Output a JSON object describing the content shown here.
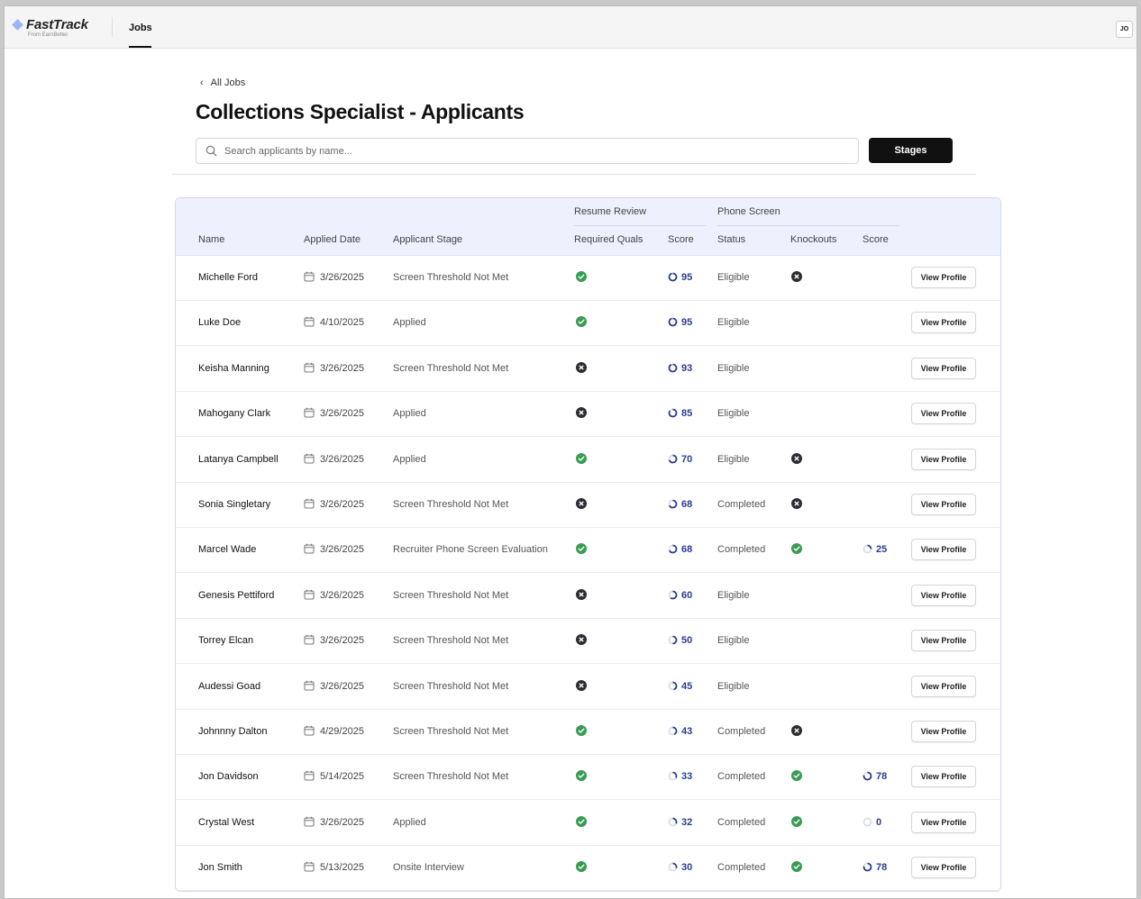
{
  "app": {
    "logo": "FastTrack",
    "logo_sub": "From EarnBetter",
    "nav_jobs": "Jobs",
    "avatar": "JO"
  },
  "page": {
    "back_label": "All Jobs",
    "title": "Collections Specialist - Applicants",
    "search_placeholder": "Search applicants by name...",
    "stages_label": "Stages"
  },
  "table": {
    "groups": {
      "resume_review": "Resume Review",
      "phone_screen": "Phone Screen"
    },
    "headers": {
      "name": "Name",
      "applied_date": "Applied Date",
      "stage": "Applicant Stage",
      "required_quals": "Required Quals",
      "resume_score": "Score",
      "status": "Status",
      "knockouts": "Knockouts",
      "phone_score": "Score"
    },
    "view_label": "View Profile",
    "colors": {
      "ok": "#3a9b55",
      "fail": "#2b2d33",
      "score": "#2a3d8f"
    },
    "rows": [
      {
        "name": "Michelle Ford",
        "date": "3/26/2025",
        "stage": "Screen Threshold Not Met",
        "quals": "ok",
        "score": "95",
        "score_value": 95,
        "status": "Eligible",
        "knockouts": "fail",
        "phone_score": "",
        "phone_score_value": null
      },
      {
        "name": "Luke Doe",
        "date": "4/10/2025",
        "stage": "Applied",
        "quals": "ok",
        "score": "95",
        "score_value": 95,
        "status": "Eligible",
        "knockouts": "",
        "phone_score": "",
        "phone_score_value": null
      },
      {
        "name": "Keisha Manning",
        "date": "3/26/2025",
        "stage": "Screen Threshold Not Met",
        "quals": "fail",
        "score": "93",
        "score_value": 93,
        "status": "Eligible",
        "knockouts": "",
        "phone_score": "",
        "phone_score_value": null
      },
      {
        "name": "Mahogany Clark",
        "date": "3/26/2025",
        "stage": "Applied",
        "quals": "fail",
        "score": "85",
        "score_value": 85,
        "status": "Eligible",
        "knockouts": "",
        "phone_score": "",
        "phone_score_value": null
      },
      {
        "name": "Latanya Campbell",
        "date": "3/26/2025",
        "stage": "Applied",
        "quals": "ok",
        "score": "70",
        "score_value": 70,
        "status": "Eligible",
        "knockouts": "fail",
        "phone_score": "",
        "phone_score_value": null
      },
      {
        "name": "Sonia Singletary",
        "date": "3/26/2025",
        "stage": "Screen Threshold Not Met",
        "quals": "fail",
        "score": "68",
        "score_value": 68,
        "status": "Completed",
        "knockouts": "fail",
        "phone_score": "",
        "phone_score_value": null
      },
      {
        "name": "Marcel Wade",
        "date": "3/26/2025",
        "stage": "Recruiter Phone Screen Evaluation",
        "quals": "ok",
        "score": "68",
        "score_value": 68,
        "status": "Completed",
        "knockouts": "ok",
        "phone_score": "25",
        "phone_score_value": 25
      },
      {
        "name": "Genesis Pettiford",
        "date": "3/26/2025",
        "stage": "Screen Threshold Not Met",
        "quals": "fail",
        "score": "60",
        "score_value": 60,
        "status": "Eligible",
        "knockouts": "",
        "phone_score": "",
        "phone_score_value": null
      },
      {
        "name": "Torrey Elcan",
        "date": "3/26/2025",
        "stage": "Screen Threshold Not Met",
        "quals": "fail",
        "score": "50",
        "score_value": 50,
        "status": "Eligible",
        "knockouts": "",
        "phone_score": "",
        "phone_score_value": null
      },
      {
        "name": "Audessi Goad",
        "date": "3/26/2025",
        "stage": "Screen Threshold Not Met",
        "quals": "fail",
        "score": "45",
        "score_value": 45,
        "status": "Eligible",
        "knockouts": "",
        "phone_score": "",
        "phone_score_value": null
      },
      {
        "name": "Johnnny Dalton",
        "date": "4/29/2025",
        "stage": "Screen Threshold Not Met",
        "quals": "ok",
        "score": "43",
        "score_value": 43,
        "status": "Completed",
        "knockouts": "fail",
        "phone_score": "",
        "phone_score_value": null
      },
      {
        "name": "Jon Davidson",
        "date": "5/14/2025",
        "stage": "Screen Threshold Not Met",
        "quals": "ok",
        "score": "33",
        "score_value": 33,
        "status": "Completed",
        "knockouts": "ok",
        "phone_score": "78",
        "phone_score_value": 78
      },
      {
        "name": "Crystal West",
        "date": "3/26/2025",
        "stage": "Applied",
        "quals": "ok",
        "score": "32",
        "score_value": 32,
        "status": "Completed",
        "knockouts": "ok",
        "phone_score": "0",
        "phone_score_value": 0
      },
      {
        "name": "Jon Smith",
        "date": "5/13/2025",
        "stage": "Onsite Interview",
        "quals": "ok",
        "score": "30",
        "score_value": 30,
        "status": "Completed",
        "knockouts": "ok",
        "phone_score": "78",
        "phone_score_value": 78
      }
    ]
  }
}
